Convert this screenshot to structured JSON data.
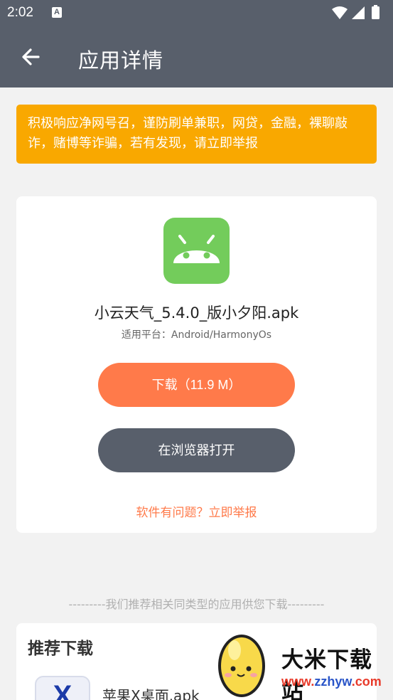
{
  "status_bar": {
    "time": "2:02",
    "notification_icon": "a-app-icon"
  },
  "app_bar": {
    "title": "应用详情",
    "back_icon": "arrow-left-icon"
  },
  "notice": {
    "text": "积极响应净网号召，谨防刷单兼职，网贷，金融，裸聊敲诈，赌博等诈骗，若有发现，请立即举报"
  },
  "app": {
    "name": "小云天气_5.4.0_版小夕阳.apk",
    "platform": "适用平台：Android/HarmonyOs",
    "download_label": "下载（11.9 M）",
    "browser_label": "在浏览器打开",
    "report_label": "软件有问题？立即举报",
    "icon": "android-icon"
  },
  "recommend": {
    "note": "---------我们推荐相关同类型的应用供您下载---------",
    "title": "推荐下载",
    "items": [
      {
        "name": "苹果X桌面.apk",
        "icon_letter": "X"
      }
    ]
  },
  "watermark": {
    "brand": "大米下载站",
    "url_prefix": "www.",
    "url_domain": "zzhyw",
    "url_suffix": ".com"
  },
  "colors": {
    "header": "#585f6b",
    "notice": "#f9a800",
    "accent": "#ff7a4a",
    "app_icon": "#73cc5b"
  }
}
